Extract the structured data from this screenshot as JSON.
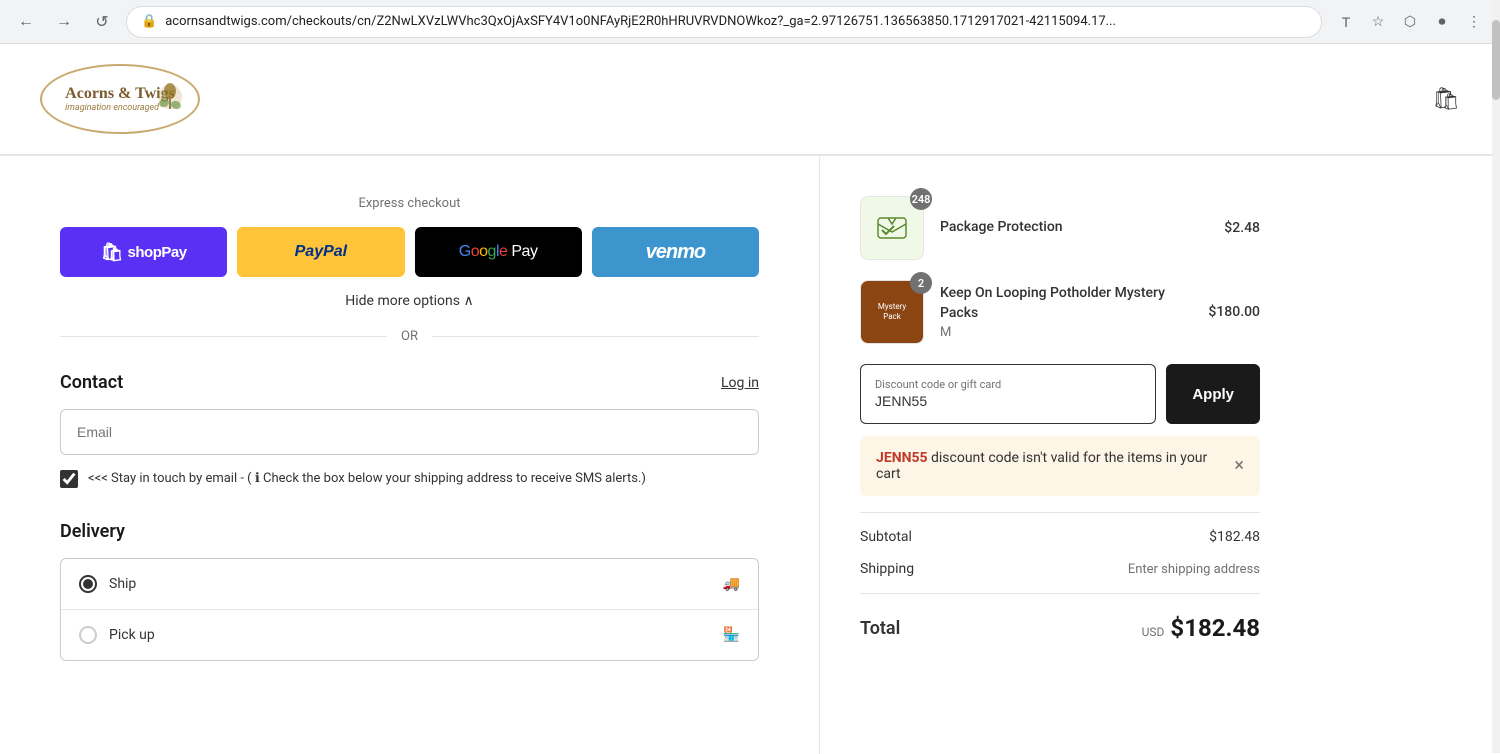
{
  "browser": {
    "back_btn": "←",
    "forward_btn": "→",
    "reload_btn": "↺",
    "url": "acornsandtwigs.com/checkouts/cn/Z2NwLXVzLWVhc3QxOjAxSFY4V1o0NFAyRjE2R0hHRUVRVDNOWkoz?_ga=2.97126751.136563850.1712917021-42115094.17...",
    "translate_icon": "T",
    "bookmark_icon": "☆",
    "extension_icon": "⬡",
    "record_icon": "⏺",
    "menu_icon": "⋮"
  },
  "header": {
    "logo_line1": "Acorns & Twigs",
    "logo_line2": "imagination encouraged",
    "cart_icon": "🛍"
  },
  "express_checkout": {
    "title": "Express checkout",
    "shop_pay_label": "shop Pay",
    "paypal_label": "PayPal",
    "gpay_label": "G Pay",
    "venmo_label": "venmo",
    "hide_more": "Hide more options",
    "or": "OR"
  },
  "contact": {
    "section_title": "Contact",
    "log_in_label": "Log in",
    "email_placeholder": "Email",
    "checkbox_checked": true,
    "checkbox_label": "<<< Stay in touch by email - ( ℹ Check the box below your shipping address to receive SMS alerts.)"
  },
  "delivery": {
    "section_title": "Delivery",
    "options": [
      {
        "id": "ship",
        "label": "Ship",
        "selected": true,
        "icon": "🚚"
      },
      {
        "id": "pickup",
        "label": "Pick up",
        "selected": false,
        "icon": "🏪"
      }
    ]
  },
  "cart": {
    "items": [
      {
        "id": "package-protection",
        "name": "Package Protection",
        "badge": "248",
        "price": "$2.48",
        "variant": ""
      },
      {
        "id": "mystery-pack",
        "name": "Keep On Looping Potholder Mystery Packs",
        "badge": "2",
        "price": "$180.00",
        "variant": "M"
      }
    ],
    "discount": {
      "label": "Discount code or gift card",
      "value": "JENN55",
      "apply_btn": "Apply"
    },
    "error": {
      "code": "JENN55",
      "message": " discount code isn't valid for the items in your cart",
      "close": "×"
    },
    "subtotal_label": "Subtotal",
    "subtotal_value": "$182.48",
    "shipping_label": "Shipping",
    "shipping_value": "Enter shipping address",
    "total_label": "Total",
    "total_currency": "USD",
    "total_value": "$182.48"
  }
}
